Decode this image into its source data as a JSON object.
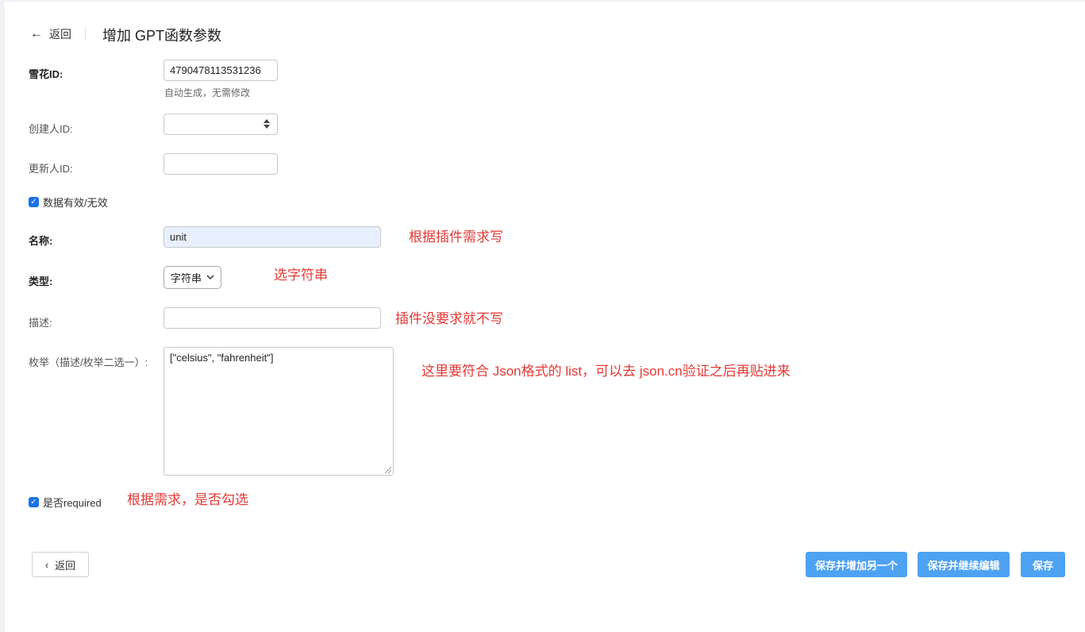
{
  "header": {
    "back_label": "返回",
    "title": "增加 GPT函数参数"
  },
  "form": {
    "snowflake_id": {
      "label": "雪花ID:",
      "value": "4790478113531236",
      "help": "自动生成，无需修改"
    },
    "creator_id": {
      "label": "创建人ID:",
      "value": ""
    },
    "updater_id": {
      "label": "更新人ID:",
      "value": ""
    },
    "valid_checkbox": {
      "label": "数据有效/无效",
      "checked": true
    },
    "name": {
      "label": "名称:",
      "value": "unit"
    },
    "type": {
      "label": "类型:",
      "selected": "字符串"
    },
    "description": {
      "label": "描述:",
      "value": ""
    },
    "enum": {
      "label": "枚举（描述/枚举二选一）:",
      "value": "[\"celsius\", \"fahrenheit\"]"
    },
    "required_checkbox": {
      "label": "是否required",
      "checked": true
    }
  },
  "annotations": {
    "name_note": "根据插件需求写",
    "type_note": "选字符串",
    "description_note": "插件没要求就不写",
    "enum_note": "这里要符合 Json格式的 list，可以去 json.cn验证之后再贴进来",
    "required_note": "根据需求，是否勾选"
  },
  "footer": {
    "back_label": "返回",
    "save_add_label": "保存并增加另一个",
    "save_continue_label": "保存并继续编辑",
    "save_label": "保存"
  },
  "colors": {
    "primary": "#4ea2f2",
    "annotation": "#e53935",
    "checkbox": "#1a73e8"
  }
}
